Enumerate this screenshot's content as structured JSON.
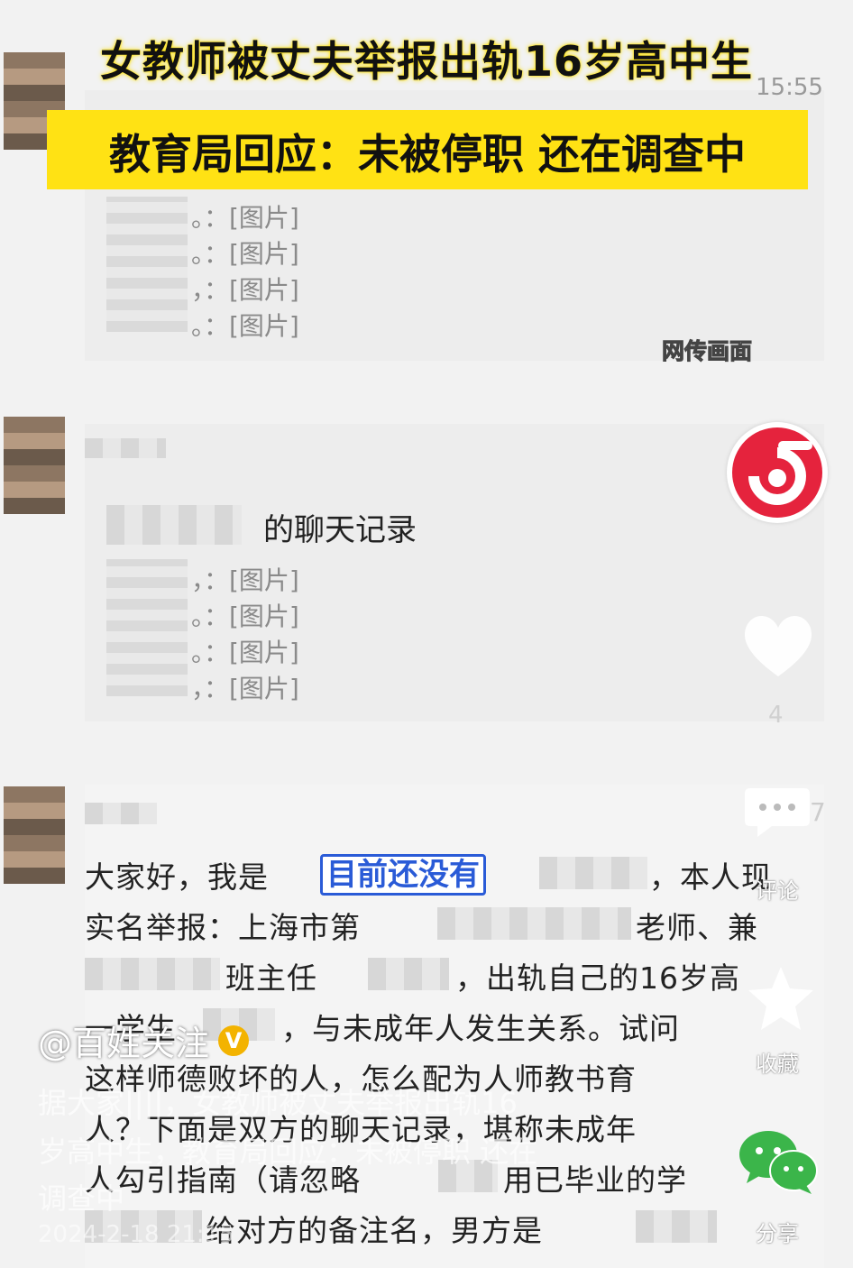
{
  "headline": "女教师被丈夫举报出轨16岁高中生",
  "subtitle": "教育局回应：未被停职 还在调查中",
  "time_stamp": "15:55",
  "image_placeholder": "。：[图片]",
  "image_placeholder_b": "，：[图片]",
  "watermark": "网传画面",
  "chat_record": "的聊天记录",
  "highlight_text": "目前还没有",
  "letter_lines": [
    "大家好，我是",
    "，本人现",
    "实名举报：上海市第",
    "老师、兼",
    "班主任",
    "，出轨自己的16岁高",
    "一学生",
    "，与未成年人发生关系。试问",
    "这样师德败坏的人，怎么配为人师教书育",
    "人？下面是双方的聊天记录，堪称未成年",
    "人勾引指南（请忽略",
    "用已毕业的学",
    "给对方的备注名，男方是"
  ],
  "like_count": "4",
  "comment_count": "7",
  "side_labels": {
    "comment": "评论",
    "favorite": "收藏",
    "share": "分享"
  },
  "account": "@百姓关注",
  "caption": "据大家|||||，女教师被丈夫举报出轨16岁高中生，教育局回应：未被停职 还在调查中",
  "caption_lines": [
    "据大家||||，女教师被丈夫举报出轨16",
    "岁高中生，教育局回应：未被停职 还在",
    "调查中"
  ],
  "date": "2024-2-18 21:15",
  "colors": {
    "highlight_bar": "#ffe214",
    "brand_red": "#e5233d",
    "wechat_green": "#3bb54a"
  }
}
